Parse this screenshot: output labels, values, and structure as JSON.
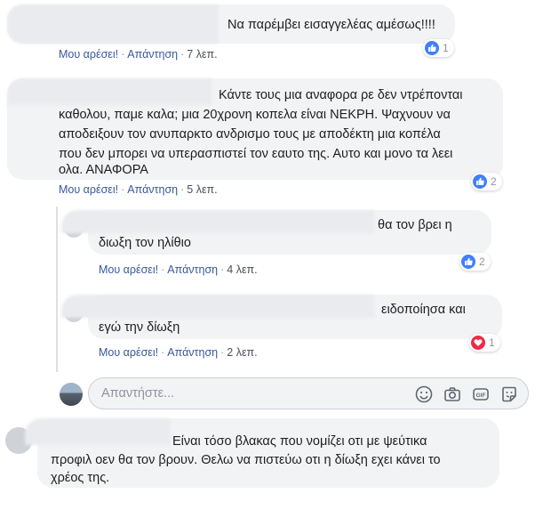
{
  "colors": {
    "link": "#385898",
    "meta_text": "#4b4f56",
    "bubble_bg": "#f2f3f5",
    "like_blue": "#4080ff",
    "love_red": "#f0284a"
  },
  "comments": [
    {
      "lines": [
        "Να παρέμβει εισαγγελέας αμέσως!!!!"
      ],
      "like_label": "Μου αρέσει!",
      "reply_label": "Απάντηση",
      "time": "7 λεπ.",
      "reaction_icon": "like-icon",
      "reaction_count": "1"
    },
    {
      "lines": [
        "Κάντε τους μια αναφορα ρε δεν ντρέπονται",
        "καθολου, παμε καλα; μια 20χρονη κοπελα είναι ΝΕΚΡΗ. Ψαχνουν να",
        "αποδειξουν τον ανυπαρκτο ανδρισμο τους με αποδέκτη μια κοπέλα",
        "που δεν μπορει να υπερασπιστεί τον εαυτο της. Αυτο και μονο τα λεει",
        "ολα. ΑΝΑΦΟΡΑ"
      ],
      "like_label": "Μου αρέσει!",
      "reply_label": "Απάντηση",
      "time": "5 λεπ.",
      "reaction_icon": "like-icon",
      "reaction_count": "2"
    }
  ],
  "replies": [
    {
      "lines": [
        "θα τον βρει η",
        "διωξη τον ηλίθιο"
      ],
      "like_label": "Μου αρέσει!",
      "reply_label": "Απάντηση",
      "time": "4 λεπ.",
      "reaction_icon": "like-icon",
      "reaction_count": "2"
    },
    {
      "lines": [
        "ειδοποίησα και",
        "εγώ την δίωξη"
      ],
      "like_label": "Μου αρέσει!",
      "reply_label": "Απάντηση",
      "time": "2 λεπ.",
      "reaction_icon": "love-icon",
      "reaction_count": "1"
    }
  ],
  "reply_box": {
    "placeholder": "Απαντήστε...",
    "icons": [
      "emoji-icon",
      "camera-icon",
      "gif-icon",
      "sticker-icon"
    ]
  },
  "last_comment": {
    "lines": [
      "Είναι τόσο βλακας που νομίζει οτι με ψεύτικα",
      "προφιλ οεν θα τον βρουν. Θελω να πιστεύω οτι η δίωξη εχει κάνει το",
      "χρέος της."
    ]
  }
}
